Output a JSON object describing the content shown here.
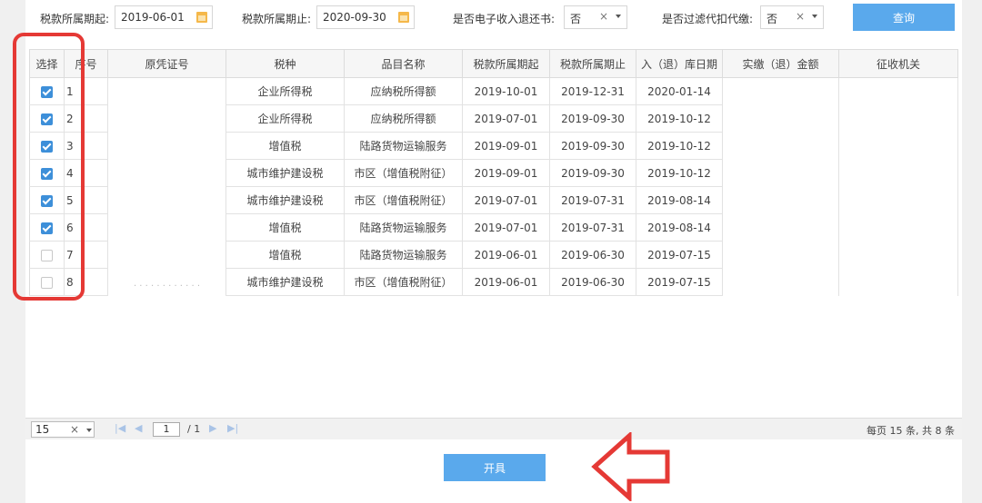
{
  "filters": {
    "start_label": "税款所属期起:",
    "start_value": "2019-06-01",
    "end_label": "税款所属期止:",
    "end_value": "2020-09-30",
    "einvoice_label": "是否电子收入退还书:",
    "einvoice_value": "否",
    "filter_withhold_label": "是否过滤代扣代缴:",
    "filter_withhold_value": "否",
    "query_label": "查询"
  },
  "table": {
    "headers": [
      "选择",
      "序号",
      "原凭证号",
      "税种",
      "品目名称",
      "税款所属期起",
      "税款所属期止",
      "入（退）库日期",
      "实缴（退）金额",
      "征收机关"
    ],
    "rows": [
      {
        "checked": true,
        "seq": "1",
        "tax": "企业所得税",
        "item": "应纳税所得额",
        "start": "2019-10-01",
        "end": "2019-12-31",
        "date": "2020-01-14"
      },
      {
        "checked": true,
        "seq": "2",
        "tax": "企业所得税",
        "item": "应纳税所得额",
        "start": "2019-07-01",
        "end": "2019-09-30",
        "date": "2019-10-12"
      },
      {
        "checked": true,
        "seq": "3",
        "tax": "增值税",
        "item": "陆路货物运输服务",
        "start": "2019-09-01",
        "end": "2019-09-30",
        "date": "2019-10-12"
      },
      {
        "checked": true,
        "seq": "4",
        "tax": "城市维护建设税",
        "item": "市区（增值税附征）",
        "start": "2019-09-01",
        "end": "2019-09-30",
        "date": "2019-10-12"
      },
      {
        "checked": true,
        "seq": "5",
        "tax": "城市维护建设税",
        "item": "市区（增值税附征）",
        "start": "2019-07-01",
        "end": "2019-07-31",
        "date": "2019-08-14"
      },
      {
        "checked": true,
        "seq": "6",
        "tax": "增值税",
        "item": "陆路货物运输服务",
        "start": "2019-07-01",
        "end": "2019-07-31",
        "date": "2019-08-14"
      },
      {
        "checked": false,
        "seq": "7",
        "tax": "增值税",
        "item": "陆路货物运输服务",
        "start": "2019-06-01",
        "end": "2019-06-30",
        "date": "2019-07-15"
      },
      {
        "checked": false,
        "seq": "8",
        "tax": "城市维护建设税",
        "item": "市区（增值税附征）",
        "start": "2019-06-01",
        "end": "2019-06-30",
        "date": "2019-07-15"
      }
    ]
  },
  "pager": {
    "page_size": "15",
    "current_page": "1",
    "total_pages": "/ 1",
    "info": "每页 15 条, 共 8 条"
  },
  "actions": {
    "open_label": "开具"
  },
  "colors": {
    "accent": "#5aa9ec",
    "checkbox": "#3d8fd9",
    "highlight": "#e53935"
  }
}
